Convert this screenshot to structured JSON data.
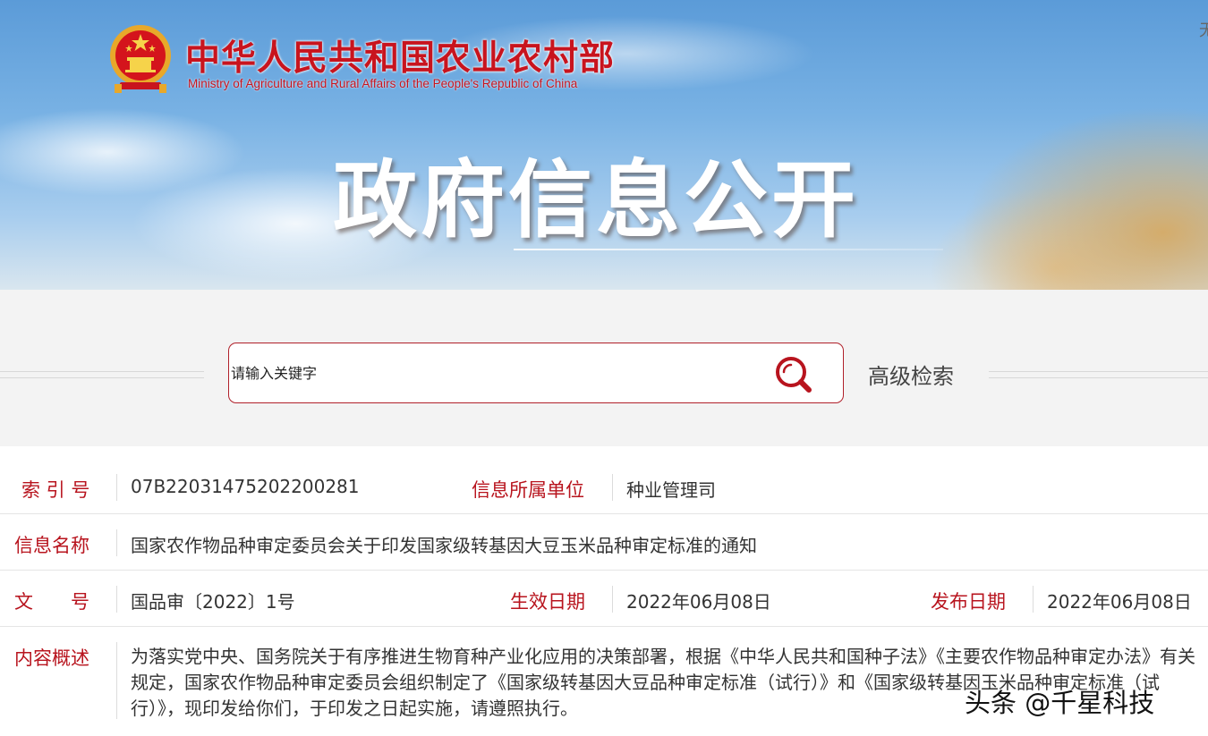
{
  "header": {
    "ministry_cn": "中华人民共和国农业农村部",
    "ministry_en": "Ministry of Agriculture and Rural Affairs of the People's Republic of China",
    "banner_title": "政府信息公开",
    "corner_char": "无"
  },
  "search": {
    "placeholder": "请输入关键字",
    "advanced_label": "高级检索",
    "icon": "search-icon"
  },
  "info": {
    "index_label": "索 引 号",
    "index_value": "07B22031475202200281",
    "unit_label": "信息所属单位",
    "unit_value": "种业管理司",
    "name_label": "信息名称",
    "name_value": "国家农作物品种审定委员会关于印发国家级转基因大豆玉米品种审定标准的通知",
    "doc_label": "文　　号",
    "doc_value": "国品审〔2022〕1号",
    "effective_label": "生效日期",
    "effective_value": "2022年06月08日",
    "publish_label": "发布日期",
    "publish_value": "2022年06月08日",
    "summary_label": "内容概述",
    "summary_value": "为落实党中央、国务院关于有序推进生物育种产业化应用的决策部署，根据《中华人民共和国种子法》《主要农作物品种审定办法》有关规定，国家农作物品种审定委员会组织制定了《国家级转基因大豆品种审定标准（试行）》和《国家级转基因玉米品种审定标准（试行）》，现印发给你们，于印发之日起实施，请遵照执行。"
  },
  "watermark": "头条 @千星科技",
  "colors": {
    "brand_red": "#c8141e",
    "label_red": "#b8141e",
    "search_border": "#b0202a"
  }
}
